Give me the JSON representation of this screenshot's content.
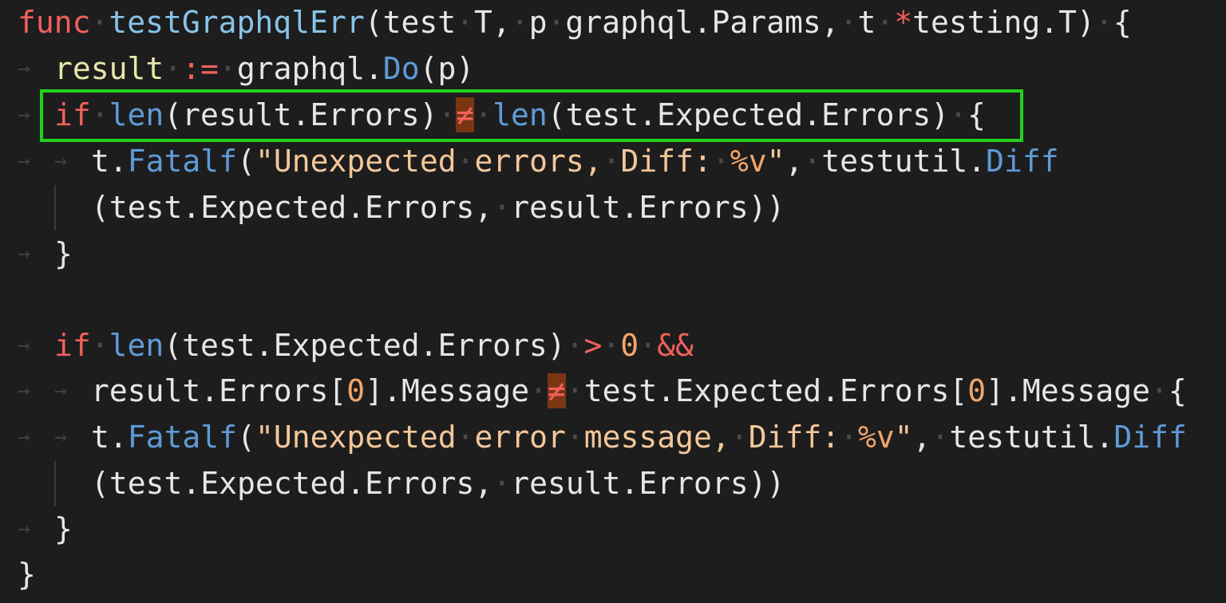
{
  "editor": {
    "lines": [
      {
        "id": "l1",
        "tokens": [
          {
            "t": "func",
            "c": "kw"
          },
          {
            "t": "·",
            "c": "dot"
          },
          {
            "t": "testGraphqlErr",
            "c": "fn"
          },
          {
            "t": "(test",
            "c": "plain"
          },
          {
            "t": "·",
            "c": "dot"
          },
          {
            "t": "T,",
            "c": "plain"
          },
          {
            "t": "·",
            "c": "dot"
          },
          {
            "t": "p",
            "c": "plain"
          },
          {
            "t": "·",
            "c": "dot"
          },
          {
            "t": "graphql.Params,",
            "c": "plain"
          },
          {
            "t": "·",
            "c": "dot"
          },
          {
            "t": "t",
            "c": "plain"
          },
          {
            "t": "·",
            "c": "dot"
          },
          {
            "t": "*",
            "c": "op"
          },
          {
            "t": "testing.T)",
            "c": "plain"
          },
          {
            "t": "·",
            "c": "dot"
          },
          {
            "t": "{",
            "c": "plain"
          }
        ]
      },
      {
        "id": "l2",
        "tokens": [
          {
            "t": "result",
            "c": "var"
          },
          {
            "t": "·",
            "c": "dot"
          },
          {
            "t": ":=",
            "c": "op"
          },
          {
            "t": "·",
            "c": "dot"
          },
          {
            "t": "graphql.",
            "c": "plain"
          },
          {
            "t": "Do",
            "c": "meth"
          },
          {
            "t": "(p)",
            "c": "plain"
          }
        ]
      },
      {
        "id": "l3",
        "tokens": [
          {
            "t": "if",
            "c": "kw"
          },
          {
            "t": "·",
            "c": "dot"
          },
          {
            "t": "len",
            "c": "meth"
          },
          {
            "t": "(result.Errors)",
            "c": "plain"
          },
          {
            "t": "·",
            "c": "dot"
          },
          {
            "t": "≠",
            "c": "neq"
          },
          {
            "t": "·",
            "c": "dot"
          },
          {
            "t": "len",
            "c": "meth"
          },
          {
            "t": "(test.Expected.Errors)",
            "c": "plain"
          },
          {
            "t": "·",
            "c": "dot"
          },
          {
            "t": "{",
            "c": "plain"
          }
        ]
      },
      {
        "id": "l4",
        "tokens": [
          {
            "t": "t.",
            "c": "plain"
          },
          {
            "t": "Fatalf",
            "c": "meth"
          },
          {
            "t": "(",
            "c": "plain"
          },
          {
            "t": "\"Unexpected",
            "c": "str"
          },
          {
            "t": "·",
            "c": "dot"
          },
          {
            "t": "errors,",
            "c": "str"
          },
          {
            "t": "·",
            "c": "dot"
          },
          {
            "t": "Diff:",
            "c": "str"
          },
          {
            "t": "·",
            "c": "dot"
          },
          {
            "t": "%v",
            "c": "num"
          },
          {
            "t": "\"",
            "c": "str"
          },
          {
            "t": ",",
            "c": "plain"
          },
          {
            "t": "·",
            "c": "dot"
          },
          {
            "t": "testutil.",
            "c": "plain"
          },
          {
            "t": "Diff",
            "c": "meth"
          }
        ]
      },
      {
        "id": "l5",
        "tokens": [
          {
            "t": "(test.Expected.Errors,",
            "c": "plain"
          },
          {
            "t": "·",
            "c": "dot"
          },
          {
            "t": "result.Errors))",
            "c": "plain"
          }
        ]
      },
      {
        "id": "l6",
        "tokens": [
          {
            "t": "}",
            "c": "plain"
          }
        ]
      },
      {
        "id": "l7",
        "tokens": []
      },
      {
        "id": "l8",
        "tokens": [
          {
            "t": "if",
            "c": "kw"
          },
          {
            "t": "·",
            "c": "dot"
          },
          {
            "t": "len",
            "c": "meth"
          },
          {
            "t": "(test.Expected.Errors)",
            "c": "plain"
          },
          {
            "t": "·",
            "c": "dot"
          },
          {
            "t": ">",
            "c": "op"
          },
          {
            "t": "·",
            "c": "dot"
          },
          {
            "t": "0",
            "c": "num"
          },
          {
            "t": "·",
            "c": "dot"
          },
          {
            "t": "&&",
            "c": "op"
          }
        ]
      },
      {
        "id": "l9",
        "tokens": [
          {
            "t": "result.Errors[",
            "c": "plain"
          },
          {
            "t": "0",
            "c": "num"
          },
          {
            "t": "].Message",
            "c": "plain"
          },
          {
            "t": "·",
            "c": "dot"
          },
          {
            "t": "≠",
            "c": "neq"
          },
          {
            "t": "·",
            "c": "dot"
          },
          {
            "t": "test.Expected.Errors[",
            "c": "plain"
          },
          {
            "t": "0",
            "c": "num"
          },
          {
            "t": "].Message",
            "c": "plain"
          },
          {
            "t": "·",
            "c": "dot"
          },
          {
            "t": "{",
            "c": "plain"
          }
        ]
      },
      {
        "id": "l10",
        "tokens": [
          {
            "t": "t.",
            "c": "plain"
          },
          {
            "t": "Fatalf",
            "c": "meth"
          },
          {
            "t": "(",
            "c": "plain"
          },
          {
            "t": "\"Unexpected",
            "c": "str"
          },
          {
            "t": "·",
            "c": "dot"
          },
          {
            "t": "error",
            "c": "str"
          },
          {
            "t": "·",
            "c": "dot"
          },
          {
            "t": "message,",
            "c": "str"
          },
          {
            "t": "·",
            "c": "dot"
          },
          {
            "t": "Diff:",
            "c": "str"
          },
          {
            "t": "·",
            "c": "dot"
          },
          {
            "t": "%v",
            "c": "num"
          },
          {
            "t": "\"",
            "c": "str"
          },
          {
            "t": ",",
            "c": "plain"
          },
          {
            "t": "·",
            "c": "dot"
          },
          {
            "t": "testutil.",
            "c": "plain"
          },
          {
            "t": "Diff",
            "c": "meth"
          }
        ]
      },
      {
        "id": "l11",
        "tokens": [
          {
            "t": "(test.Expected.Errors,",
            "c": "plain"
          },
          {
            "t": "·",
            "c": "dot"
          },
          {
            "t": "result.Errors))",
            "c": "plain"
          }
        ]
      },
      {
        "id": "l12",
        "tokens": [
          {
            "t": "}",
            "c": "plain"
          }
        ]
      },
      {
        "id": "l13",
        "tokens": [
          {
            "t": "}",
            "c": "plain"
          }
        ]
      }
    ],
    "tab_glyph": "→"
  },
  "colors": {
    "background": "#1d1d1d",
    "keyword": "#f0605c",
    "function": "#88c4e8",
    "method": "#5f9bd8",
    "string": "#f3c79a",
    "number": "#f3a66b",
    "highlight_border": "#22d11c",
    "neq_background": "#7a3512"
  }
}
